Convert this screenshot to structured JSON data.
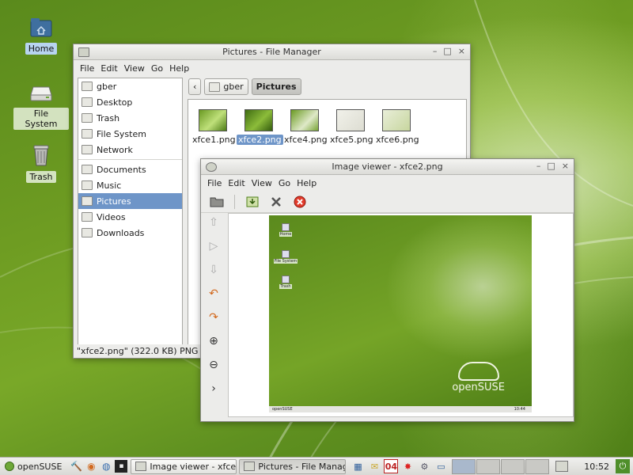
{
  "desktop": {
    "icons": [
      {
        "label": "Home"
      },
      {
        "label": "File System"
      },
      {
        "label": "Trash"
      }
    ]
  },
  "file_manager": {
    "title": "Pictures - File Manager",
    "controls": {
      "minimize": "–",
      "maximize": "□",
      "close": "×"
    },
    "menu": [
      "File",
      "Edit",
      "View",
      "Go",
      "Help"
    ],
    "sidebar": {
      "places": [
        "gber",
        "Desktop",
        "Trash",
        "File System",
        "Network"
      ],
      "bookmarks": [
        "Documents",
        "Music",
        "Pictures",
        "Videos",
        "Downloads"
      ],
      "active": "Pictures"
    },
    "path": {
      "back": "‹",
      "items": [
        "gber",
        "Pictures"
      ]
    },
    "files": [
      {
        "name": "xfce1.png"
      },
      {
        "name": "xfce2.png"
      },
      {
        "name": "xfce4.png"
      },
      {
        "name": "xfce5.png"
      },
      {
        "name": "xfce6.png"
      }
    ],
    "selected_file": "xfce2.png",
    "status": "\"xfce2.png\" (322.0 KB) PNG ima"
  },
  "image_viewer": {
    "title": "Image viewer - xfce2.png",
    "controls": {
      "minimize": "–",
      "maximize": "□",
      "close": "×"
    },
    "menu": [
      "File",
      "Edit",
      "View",
      "Go",
      "Help"
    ],
    "preview": {
      "icons": [
        "Home",
        "File System",
        "Trash"
      ],
      "brand": "openSUSE",
      "panel_start": "openSUSE",
      "panel_clock": "10:44"
    },
    "nav_chevron": "›"
  },
  "panel": {
    "start": "openSUSE",
    "tasks": [
      {
        "label": "Image viewer - xfce2...",
        "active": false
      },
      {
        "label": "Pictures - File Manager",
        "active": true
      }
    ],
    "calendar_day": "04",
    "clock": "10:52"
  },
  "colors": {
    "selection": "#6e95c8",
    "desktop_green": "#6e9c22"
  }
}
